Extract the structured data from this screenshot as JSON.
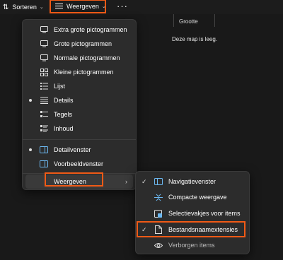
{
  "toolbar": {
    "sort_label": "Sorteren",
    "view_label": "Weergeven",
    "more_label": "···"
  },
  "listing": {
    "column_size": "Grootte",
    "empty_message": "Deze map is leeg."
  },
  "view_menu": {
    "items": [
      {
        "label": "Extra grote pictogrammen",
        "icon": "monitor-icon"
      },
      {
        "label": "Grote pictogrammen",
        "icon": "monitor-icon"
      },
      {
        "label": "Normale pictogrammen",
        "icon": "monitor-icon"
      },
      {
        "label": "Kleine pictogrammen",
        "icon": "small-icons-icon"
      },
      {
        "label": "Lijst",
        "icon": "list-icon"
      },
      {
        "label": "Details",
        "icon": "details-icon",
        "selected": true
      },
      {
        "label": "Tegels",
        "icon": "tiles-icon"
      },
      {
        "label": "Inhoud",
        "icon": "content-icon"
      },
      {
        "label": "Detailvenster",
        "icon": "details-pane-icon",
        "selected": true
      },
      {
        "label": "Voorbeeldvenster",
        "icon": "preview-pane-icon"
      },
      {
        "label": "Weergeven",
        "icon": "",
        "submenu": true
      }
    ]
  },
  "show_submenu": {
    "items": [
      {
        "label": "Navigatievenster",
        "icon": "navigation-pane-icon",
        "checked": true
      },
      {
        "label": "Compacte weergave",
        "icon": "compact-view-icon"
      },
      {
        "label": "Selectievakjes voor items",
        "icon": "checkbox-icon"
      },
      {
        "label": "Bestandsnaamextensies",
        "icon": "file-icon",
        "checked": true
      },
      {
        "label": "Verborgen items",
        "icon": "eye-icon"
      }
    ]
  },
  "colors": {
    "highlight": "#f05a16",
    "menu_bg": "#2c2c2c",
    "background": "#191919"
  }
}
